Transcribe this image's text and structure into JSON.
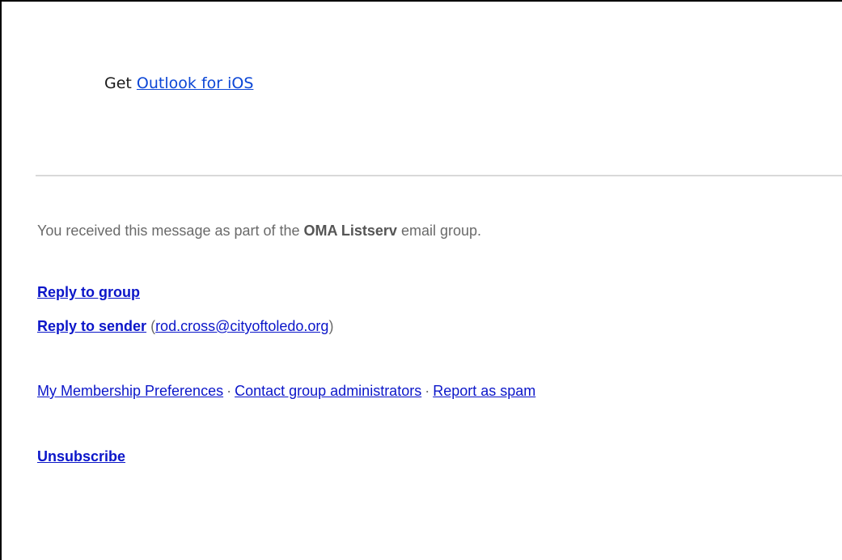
{
  "outlook": {
    "prefix": "Get",
    "link_label": "Outlook for iOS"
  },
  "footer": {
    "received_prefix": "You received this message as part of the",
    "group_name": "OMA Listserv",
    "received_suffix": "email group.",
    "reply_to_group": "Reply to group",
    "reply_to_sender": "Reply to sender",
    "sender_email": "rod.cross@cityoftoledo.org",
    "open_paren": "(",
    "close_paren": ")",
    "separator": "·",
    "preferences": "My Membership Preferences",
    "contact_admins": "Contact group administrators",
    "report_spam": "Report as spam",
    "unsubscribe": "Unsubscribe"
  },
  "colors": {
    "link": "#0b16c9",
    "outlook_link": "#0b46d6",
    "muted_text": "#6a6a6a",
    "divider": "#d9d9d9"
  }
}
